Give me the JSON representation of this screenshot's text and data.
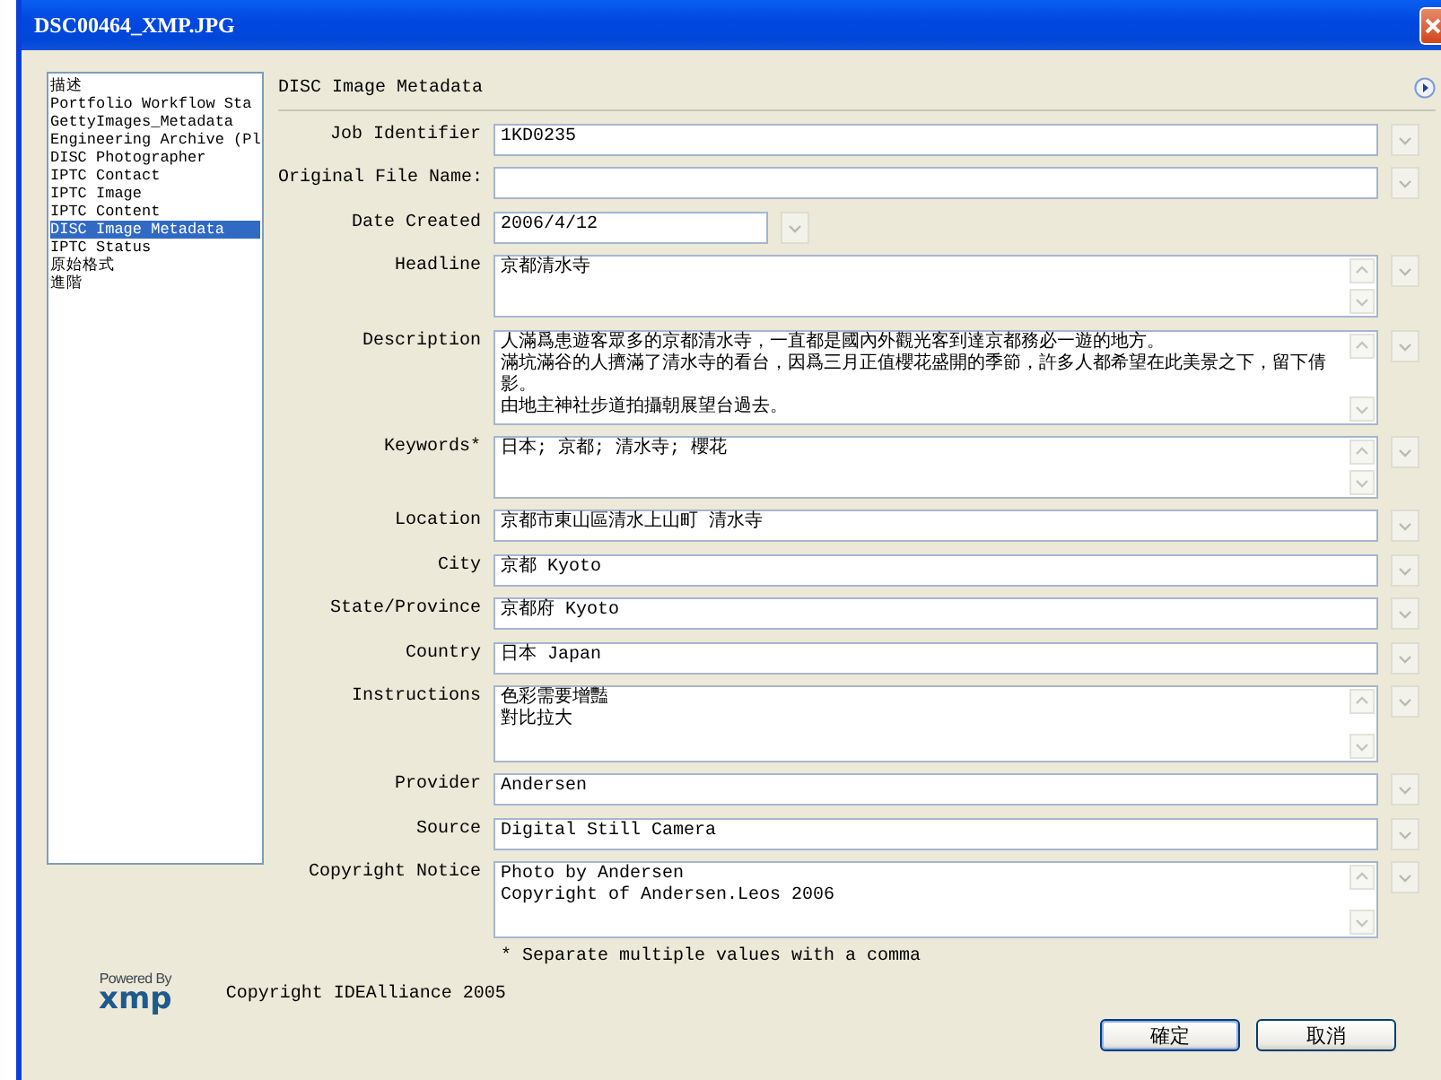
{
  "window": {
    "title": "DSC00464_XMP.JPG"
  },
  "sidebar": {
    "items": [
      {
        "label": "描述",
        "selected": false
      },
      {
        "label": "Portfolio Workflow Sta",
        "selected": false
      },
      {
        "label": "GettyImages_Metadata",
        "selected": false
      },
      {
        "label": "Engineering Archive (Pl",
        "selected": false
      },
      {
        "label": "DISC Photographer",
        "selected": false
      },
      {
        "label": "IPTC Contact",
        "selected": false
      },
      {
        "label": "IPTC Image",
        "selected": false
      },
      {
        "label": "IPTC Content",
        "selected": false
      },
      {
        "label": "DISC Image Metadata",
        "selected": true
      },
      {
        "label": "IPTC Status",
        "selected": false
      },
      {
        "label": "原始格式",
        "selected": false
      },
      {
        "label": "進階",
        "selected": false
      }
    ]
  },
  "panel": {
    "title": "DISC Image Metadata",
    "fields": [
      {
        "label": "Job Identifier",
        "kind": "line",
        "value": "1KD0235"
      },
      {
        "label": "Original File Name:",
        "kind": "line"
      },
      {
        "label": "Date Created",
        "kind": "date",
        "value": "2006/4/12"
      },
      {
        "label": "Headline",
        "kind": "box",
        "value": "京都清水寺"
      },
      {
        "label": "Description",
        "kind": "bigbox",
        "lines": [
          "人滿爲患遊客眾多的京都清水寺，一直都是國內外觀光客到達京都務必一遊的地方。",
          "滿坑滿谷的人擠滿了清水寺的看台，因爲三月正值櫻花盛開的季節，許多人都希望在此美景之下，留下倩影。",
          "由地主神社步道拍攝朝展望台過去。"
        ]
      },
      {
        "label": "Keywords*",
        "kind": "box",
        "value": "日本; 京都; 清水寺; 櫻花"
      },
      {
        "label": "Location",
        "kind": "line",
        "value": "京都市東山區清水上山町 清水寺"
      },
      {
        "label": "City",
        "kind": "line",
        "value": "京都 Kyoto"
      },
      {
        "label": "State/Province",
        "kind": "line",
        "value": "京都府 Kyoto"
      },
      {
        "label": "Country",
        "kind": "line",
        "value": "日本 Japan"
      },
      {
        "label": "Instructions",
        "kind": "midbox",
        "lines": [
          "色彩需要增豔",
          "對比拉大"
        ]
      },
      {
        "label": "Provider",
        "kind": "line",
        "value": "Andersen"
      },
      {
        "label": "Source",
        "kind": "line",
        "value": "Digital Still Camera"
      },
      {
        "label": "Copyright Notice",
        "kind": "midbox",
        "lines": [
          "Photo by Andersen",
          "Copyright of Andersen.Leos 2006"
        ]
      }
    ],
    "note": "* Separate multiple values with a comma"
  },
  "logo": {
    "tagline": "Powered By",
    "mark": "xmp"
  },
  "copyright": "Copyright IDEAlliance 2005",
  "buttons": [
    {
      "label": "確定",
      "default": true
    },
    {
      "label": "取消",
      "default": false
    }
  ]
}
